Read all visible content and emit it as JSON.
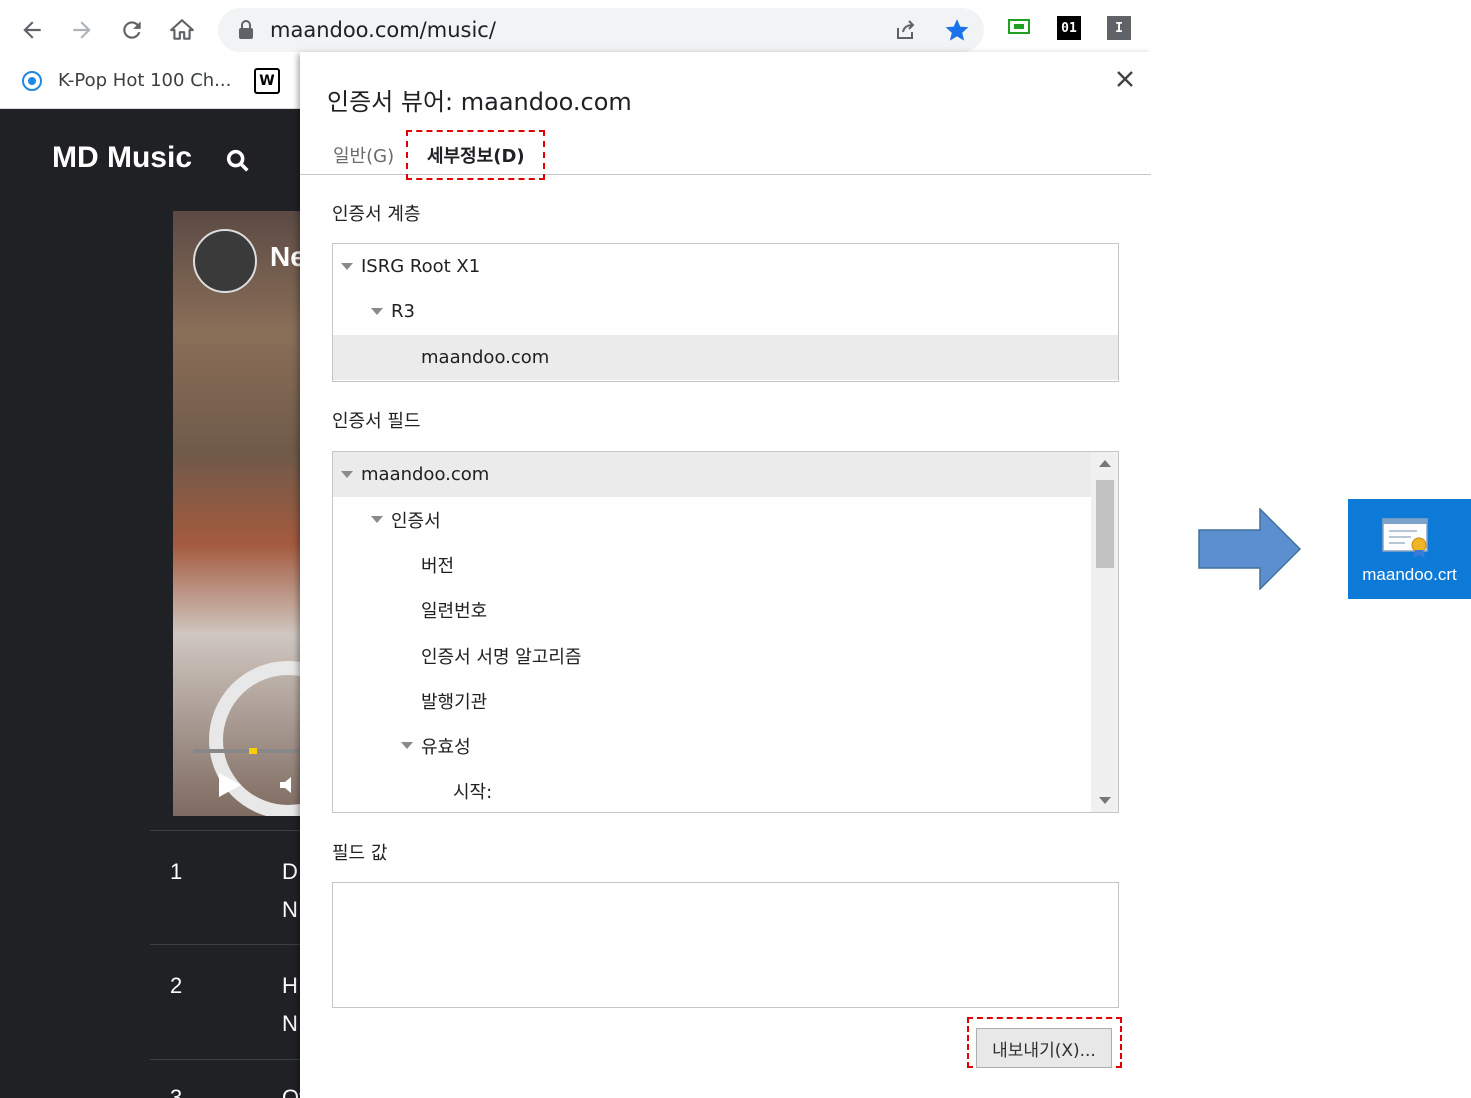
{
  "browser": {
    "url": "maandoo.com/music/",
    "bookmarks": [
      {
        "label": "K-Pop Hot 100 Ch..."
      },
      {
        "label": "W"
      }
    ],
    "extensions": [
      {
        "label": "01"
      },
      {
        "label": "I"
      }
    ]
  },
  "site": {
    "title": "MD Music",
    "video_label": "Ne",
    "tracks": [
      {
        "rank": "1",
        "line1": "D",
        "line2": "N"
      },
      {
        "rank": "2",
        "line1": "H",
        "line2": "N"
      },
      {
        "rank": "3",
        "line1": "Ov",
        "line2": ""
      }
    ]
  },
  "dialog": {
    "title": "인증서 뷰어: maandoo.com",
    "tabs": {
      "general": "일반(G)",
      "details": "세부정보(D)"
    },
    "hierarchy_label": "인증서 계층",
    "hierarchy": [
      {
        "label": "ISRG Root X1"
      },
      {
        "label": "R3"
      },
      {
        "label": "maandoo.com"
      }
    ],
    "fields_label": "인증서 필드",
    "fields": [
      {
        "label": "maandoo.com"
      },
      {
        "label": "인증서"
      },
      {
        "label": "버전"
      },
      {
        "label": "일련번호"
      },
      {
        "label": "인증서 서명 알고리즘"
      },
      {
        "label": "발행기관"
      },
      {
        "label": "유효성"
      },
      {
        "label": "시작:"
      }
    ],
    "value_label": "필드 값",
    "export_label": "내보내기(X)..."
  },
  "file": {
    "name": "maandoo.crt"
  },
  "colors": {
    "highlight": "#e00000",
    "arrow": "#5b8fcf",
    "file_tile": "#0d7ad8",
    "star": "#1a73e8"
  }
}
